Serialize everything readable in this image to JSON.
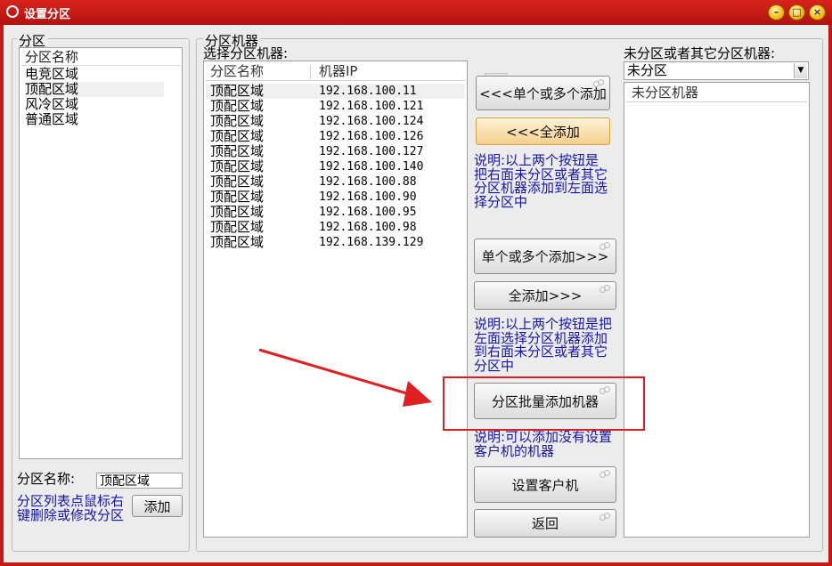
{
  "window": {
    "title": "设置分区"
  },
  "left_panel": {
    "group_label": "分区",
    "list_header": "分区名称",
    "items": [
      "电竞区域",
      "顶配区域",
      "风冷区域",
      "普通区域"
    ],
    "name_label": "分区名称:",
    "name_value": "顶配区域",
    "add_button": "添加",
    "hint": "分区列表点鼠标右键删除或修改分区"
  },
  "machines_panel": {
    "group_label": "分区机器",
    "sub_label": "选择分区机器:",
    "columns": [
      "分区名称",
      "机器IP"
    ],
    "rows": [
      [
        "顶配区域",
        "192.168.100.11"
      ],
      [
        "顶配区域",
        "192.168.100.121"
      ],
      [
        "顶配区域",
        "192.168.100.124"
      ],
      [
        "顶配区域",
        "192.168.100.126"
      ],
      [
        "顶配区域",
        "192.168.100.127"
      ],
      [
        "顶配区域",
        "192.168.100.140"
      ],
      [
        "顶配区域",
        "192.168.100.88"
      ],
      [
        "顶配区域",
        "192.168.100.90"
      ],
      [
        "顶配区域",
        "192.168.100.95"
      ],
      [
        "顶配区域",
        "192.168.100.98"
      ],
      [
        "顶配区域",
        "192.168.139.129"
      ]
    ]
  },
  "actions": {
    "help_icon": "?",
    "add_selected_left": "<<<单个或多个添加",
    "add_all_left": "<<<全添加",
    "note1": "说明:以上两个按钮是把右面未分区或者其它分区机器添加到左面选择分区中",
    "add_selected_right": "单个或多个添加>>>",
    "add_all_right": "全添加>>>",
    "note2": "说明:以上两个按钮是把左面选择分区机器添加到右面未分区或者其它分区中",
    "batch_add": "分区批量添加机器",
    "note3": "说明:可以添加没有设置客户机的机器",
    "set_client": "设置客户机",
    "back": "返回"
  },
  "right_panel": {
    "label": "未分区或者其它分区机器:",
    "select_value": "未分区",
    "list_header": "未分区机器"
  },
  "colors": {
    "title_bar": "#c41a16",
    "note_text": "#1414b4",
    "highlight_box": "#e02020"
  }
}
